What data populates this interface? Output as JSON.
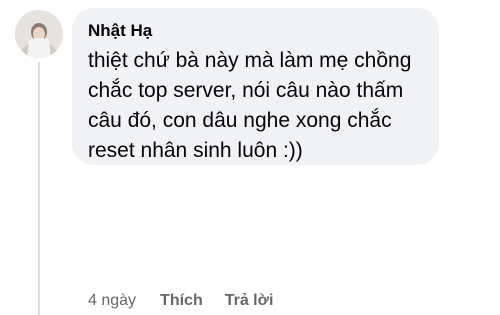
{
  "comment": {
    "author": "Nhật Hạ",
    "avatar_icon": "user-avatar",
    "text_lines": [
      "thiệt chứ bà này mà làm mẹ chồng",
      "chắc top server, nói câu nào thấm",
      "câu đó, con dâu nghe xong chắc",
      "reset nhân sinh luôn :))"
    ],
    "timestamp": "4 ngày",
    "like_label": "Thích",
    "reply_label": "Trả lời"
  },
  "colors": {
    "bubble_bg": "#f0f2f5",
    "text": "#050505",
    "meta_text": "#65676b",
    "thread_line": "#dcdfe3"
  }
}
